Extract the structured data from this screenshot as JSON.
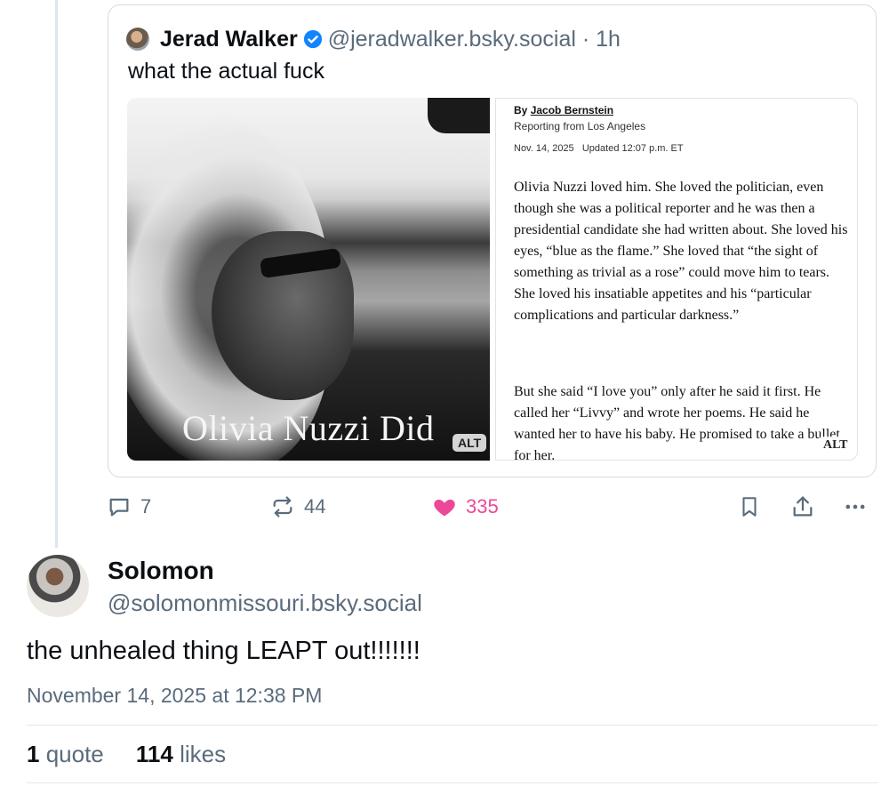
{
  "quoted_post": {
    "author_name": "Jerad Walker",
    "author_handle": "@jeradwalker.bsky.social",
    "separator": " · ",
    "time_ago": "1h",
    "text": "what the actual fuck",
    "media": {
      "image_caption": "Olivia Nuzzi Did",
      "image_alt_label": "ALT",
      "article_alt_label": "ALT",
      "article": {
        "byline_prefix": "By ",
        "byline_name": "Jacob Bernstein",
        "reporting": "Reporting from Los Angeles",
        "date": "Nov. 14, 2025",
        "updated": "Updated 12:07 p.m. ET",
        "paragraph1": "Olivia Nuzzi loved him. She loved the politician, even though she was a political reporter and he was then a presidential candidate she had written about. She loved his eyes, “blue as the flame.” She loved that “the sight of something as trivial as a rose” could move him to tears. She loved his insatiable appetites and his “particular complications and particular darkness.”",
        "paragraph2": "But she said “I love you” only after he said it first. He called her “Livvy” and wrote her poems. He said he wanted her to have his baby. He promised to take a bullet for her."
      }
    }
  },
  "actions": {
    "replies": "7",
    "reposts": "44",
    "likes": "335",
    "like_color": "#ec4899"
  },
  "reply_post": {
    "author_name": "Solomon",
    "author_handle": "@solomonmissouri.bsky.social",
    "text": "the unhealed thing LEAPT out!!!!!!!",
    "timestamp": "November 14, 2025 at 12:38 PM",
    "quote_count": "1",
    "quote_label": "quote",
    "like_count": "114",
    "like_label": "likes"
  },
  "colors": {
    "accent_blue": "#1185fe",
    "muted_text": "#5a6b7b"
  }
}
